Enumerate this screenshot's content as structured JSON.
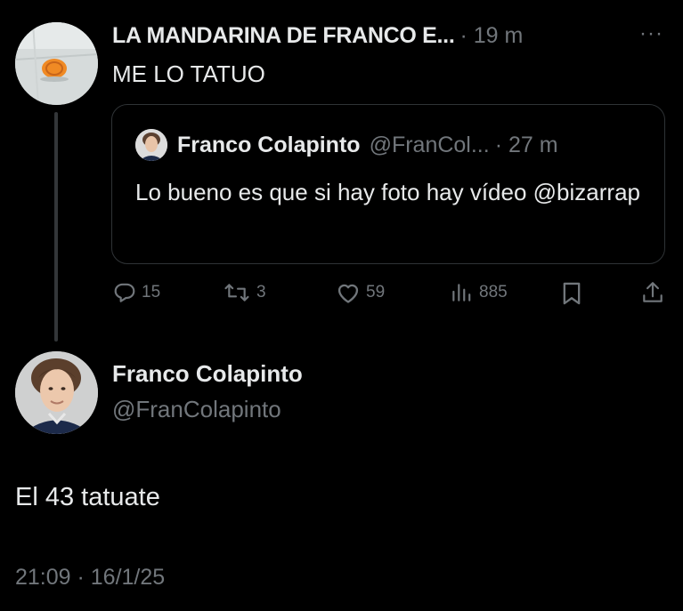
{
  "tweet": {
    "author": "LA MANDARINA DE FRANCO E...",
    "time": "· 19 m",
    "text": "ME LO TATUO",
    "more_icon": "more-icon",
    "quote": {
      "name": "Franco Colapinto",
      "handle": "@FranCol...",
      "time": "· 27 m",
      "text": "Lo bueno es que si hay foto hay vídeo @bizarrap"
    },
    "actions": {
      "replies": "15",
      "retweets": "3",
      "likes": "59",
      "views": "885"
    }
  },
  "main": {
    "name": "Franco Colapinto",
    "handle": "@FranColapinto",
    "text": "El 43 tatuate",
    "timestamp": "21:09 · 16/1/25"
  },
  "colors": {
    "background": "#000000",
    "text": "#e7e9ea",
    "muted": "#71767b",
    "border": "#2f3336"
  }
}
